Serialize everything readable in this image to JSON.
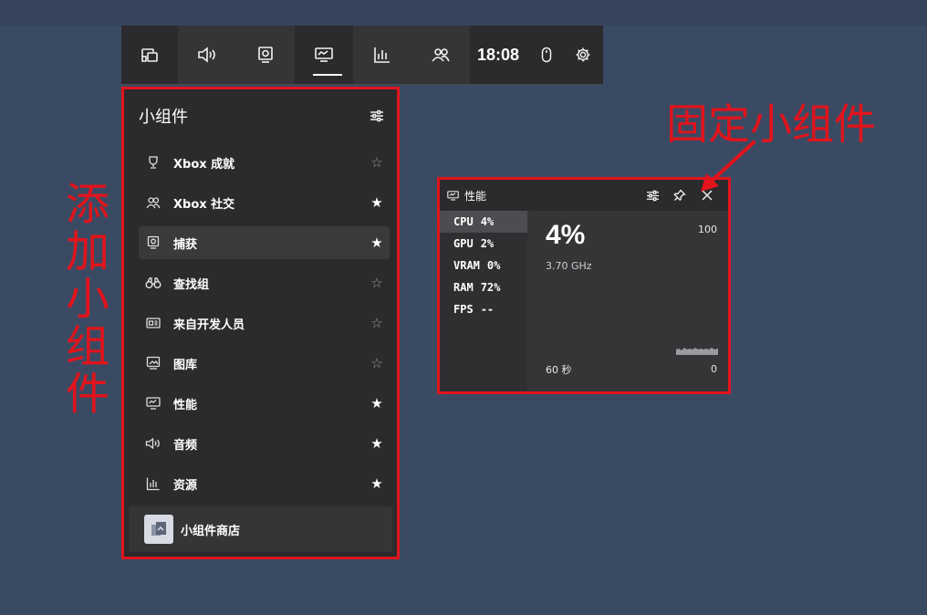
{
  "gamebar": {
    "time": "18:08",
    "buttons": [
      {
        "icon": "widget-menu-icon"
      },
      {
        "icon": "audio-icon"
      },
      {
        "icon": "capture-icon"
      },
      {
        "icon": "performance-icon"
      },
      {
        "icon": "resources-icon"
      },
      {
        "icon": "xbox-social-icon"
      }
    ]
  },
  "widgets_panel": {
    "title": "小组件",
    "items": [
      {
        "label": "Xbox 成就",
        "icon": "trophy-icon",
        "starred": false
      },
      {
        "label": "Xbox 社交",
        "icon": "people-icon",
        "starred": true
      },
      {
        "label": "捕获",
        "icon": "capture-icon",
        "starred": true
      },
      {
        "label": "查找组",
        "icon": "binoculars-icon",
        "starred": false
      },
      {
        "label": "来自开发人员",
        "icon": "news-icon",
        "starred": false
      },
      {
        "label": "图库",
        "icon": "gallery-icon",
        "starred": false
      },
      {
        "label": "性能",
        "icon": "performance-icon",
        "starred": true
      },
      {
        "label": "音频",
        "icon": "audio-icon",
        "starred": true
      },
      {
        "label": "资源",
        "icon": "resources-icon",
        "starred": true
      }
    ],
    "store_label": "小组件商店"
  },
  "performance": {
    "title": "性能",
    "metrics": [
      {
        "name": "CPU",
        "value": "4%"
      },
      {
        "name": "GPU",
        "value": "2%"
      },
      {
        "name": "VRAM",
        "value": "0%"
      },
      {
        "name": "RAM",
        "value": "72%"
      },
      {
        "name": "FPS",
        "value": "--"
      }
    ],
    "big_value": "4%",
    "frequency": "3.70 GHz",
    "graph_max": "100",
    "graph_min": "0",
    "time_window": "60 秒"
  },
  "annotations": {
    "add_widget": "添加小组件",
    "pin_widget": "固定小组件"
  },
  "colors": {
    "accent_red": "#e1141c",
    "desktop": "#3b4a63",
    "panel": "#2b2a2c"
  }
}
